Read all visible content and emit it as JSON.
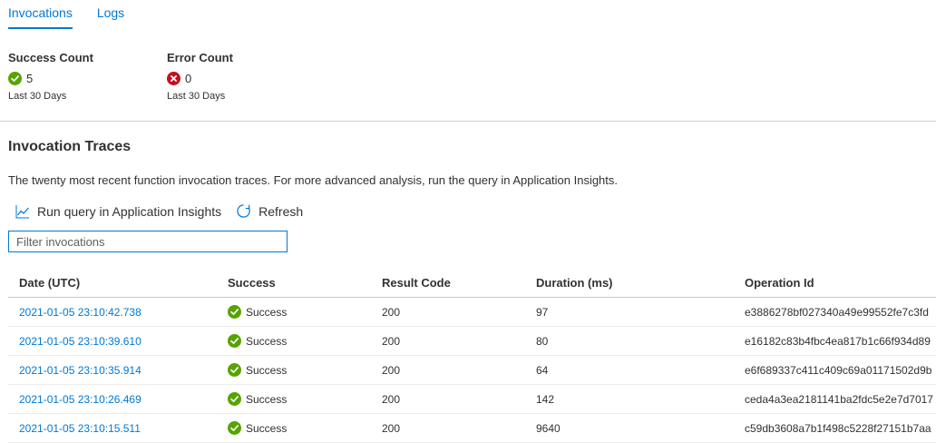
{
  "tabs": [
    {
      "label": "Invocations",
      "active": true
    },
    {
      "label": "Logs",
      "active": false
    }
  ],
  "metrics": {
    "success": {
      "label": "Success Count",
      "value": "5",
      "period": "Last 30 Days",
      "icon": "success-check-icon",
      "color": "#57a300"
    },
    "error": {
      "label": "Error Count",
      "value": "0",
      "period": "Last 30 Days",
      "icon": "error-x-icon",
      "color": "#c50f1f"
    }
  },
  "section": {
    "title": "Invocation Traces",
    "description": "The twenty most recent function invocation traces. For more advanced analysis, run the query in Application Insights."
  },
  "commands": {
    "run_query": {
      "label": "Run query in Application Insights",
      "icon": "chart-line-icon"
    },
    "refresh": {
      "label": "Refresh",
      "icon": "refresh-icon"
    }
  },
  "filter": {
    "placeholder": "Filter invocations",
    "value": ""
  },
  "table": {
    "columns": [
      "Date (UTC)",
      "Success",
      "Result Code",
      "Duration (ms)",
      "Operation Id"
    ],
    "rows": [
      {
        "date": "2021-01-05 23:10:42.738",
        "success": "Success",
        "code": "200",
        "duration": "97",
        "op": "e3886278bf027340a49e99552fe7c3fd"
      },
      {
        "date": "2021-01-05 23:10:39.610",
        "success": "Success",
        "code": "200",
        "duration": "80",
        "op": "e16182c83b4fbc4ea817b1c66f934d89"
      },
      {
        "date": "2021-01-05 23:10:35.914",
        "success": "Success",
        "code": "200",
        "duration": "64",
        "op": "e6f689337c411c409c69a01171502d9b"
      },
      {
        "date": "2021-01-05 23:10:26.469",
        "success": "Success",
        "code": "200",
        "duration": "142",
        "op": "ceda4a3ea2181141ba2fdc5e2e7d7017"
      },
      {
        "date": "2021-01-05 23:10:15.511",
        "success": "Success",
        "code": "200",
        "duration": "9640",
        "op": "c59db3608a7b1f498c5228f27151b7aa"
      }
    ]
  }
}
